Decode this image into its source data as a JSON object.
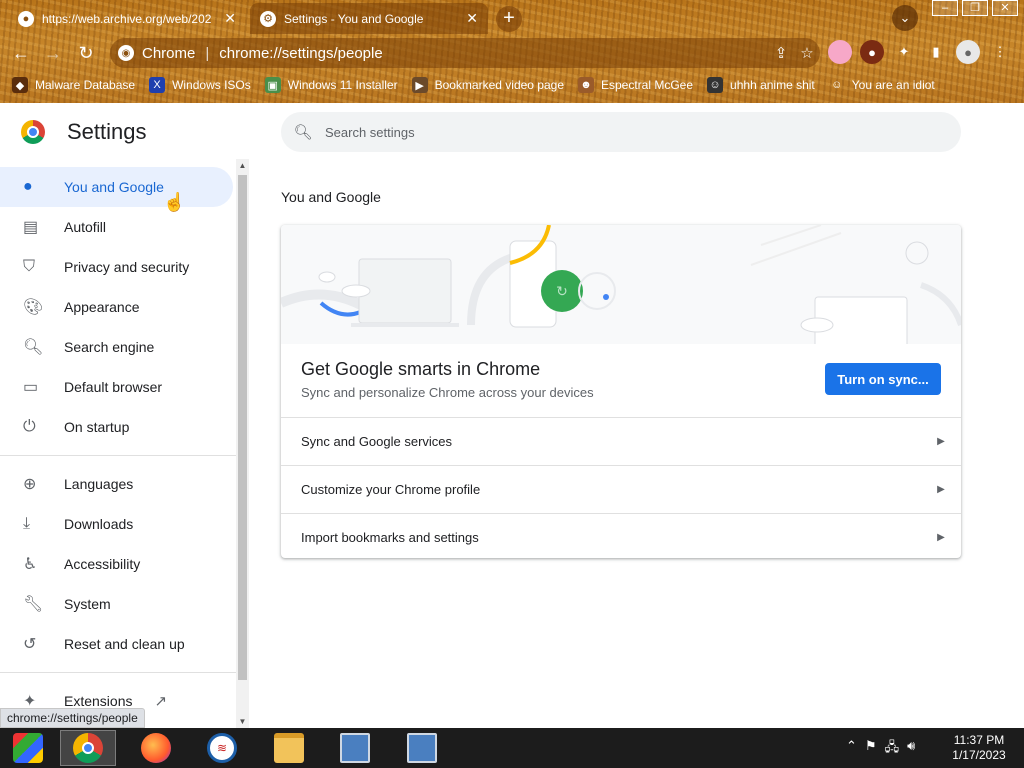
{
  "browser": {
    "tabs": [
      {
        "title": "https://web.archive.org/web/202",
        "active": false
      },
      {
        "title": "Settings - You and Google",
        "active": true
      }
    ],
    "omnibox": {
      "site": "Chrome",
      "url": "chrome://settings/people"
    },
    "bookmarks": [
      {
        "label": "Malware Database",
        "icon": "bug-icon"
      },
      {
        "label": "Windows ISOs",
        "icon": "x-icon"
      },
      {
        "label": "Windows 11 Installer",
        "icon": "image-icon"
      },
      {
        "label": "Bookmarked video page",
        "icon": "video-icon"
      },
      {
        "label": "Espectral McGee",
        "icon": "face-icon"
      },
      {
        "label": "uhhh anime shit",
        "icon": "anime-icon"
      },
      {
        "label": "You are an idiot",
        "icon": "smiley-icon"
      }
    ]
  },
  "settings": {
    "title": "Settings",
    "search_placeholder": "Search settings",
    "sidebar": [
      {
        "label": "You and Google",
        "icon": "person-icon",
        "active": true
      },
      {
        "label": "Autofill",
        "icon": "clipboard-icon"
      },
      {
        "label": "Privacy and security",
        "icon": "shield-icon"
      },
      {
        "label": "Appearance",
        "icon": "palette-icon"
      },
      {
        "label": "Search engine",
        "icon": "search-icon"
      },
      {
        "label": "Default browser",
        "icon": "browser-icon"
      },
      {
        "label": "On startup",
        "icon": "power-icon"
      },
      {
        "label": "Languages",
        "icon": "globe-icon"
      },
      {
        "label": "Downloads",
        "icon": "download-icon"
      },
      {
        "label": "Accessibility",
        "icon": "accessibility-icon"
      },
      {
        "label": "System",
        "icon": "wrench-icon"
      },
      {
        "label": "Reset and clean up",
        "icon": "history-icon"
      },
      {
        "label": "Extensions",
        "icon": "puzzle-icon"
      }
    ],
    "section_title": "You and Google",
    "promo": {
      "title": "Get Google smarts in Chrome",
      "subtitle": "Sync and personalize Chrome across your devices",
      "button": "Turn on sync..."
    },
    "rows": [
      {
        "label": "Sync and Google services"
      },
      {
        "label": "Customize your Chrome profile"
      },
      {
        "label": "Import bookmarks and settings"
      }
    ]
  },
  "status_url": "chrome://settings/people",
  "taskbar": {
    "apps": [
      "start-button",
      "chrome",
      "firefox",
      "obama-logo",
      "file-explorer",
      "network-app",
      "network-app-2"
    ],
    "clock": {
      "time": "11:37 PM",
      "date": "1/17/2023"
    }
  },
  "colors": {
    "accent": "#1a73e8",
    "active_nav_bg": "#e8f0fe",
    "active_nav_text": "#1967d2",
    "frame": "#b8741a"
  }
}
